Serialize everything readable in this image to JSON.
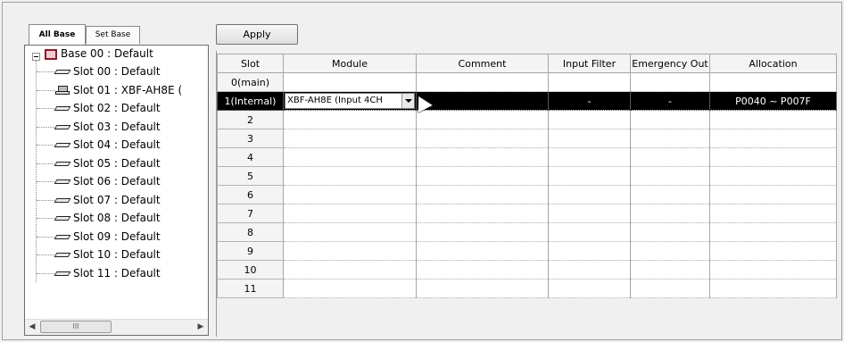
{
  "tabs": [
    "All Base",
    "Set Base"
  ],
  "apply_label": "Apply",
  "tree": {
    "root": "Base 00 : Default",
    "slots": [
      "Slot 00 : Default",
      "Slot 01 : XBF-AH8E (",
      "Slot 02 : Default",
      "Slot 03 : Default",
      "Slot 04 : Default",
      "Slot 05 : Default",
      "Slot 06 : Default",
      "Slot 07 : Default",
      "Slot 08 : Default",
      "Slot 09 : Default",
      "Slot 10 : Default",
      "Slot 11 : Default"
    ]
  },
  "scroll_thumb_label": "III",
  "grid": {
    "columns": [
      "Slot",
      "Module",
      "Comment",
      "Input Filter",
      "Emergency Out",
      "Allocation"
    ],
    "rows": [
      {
        "slot": "0(main)",
        "module": "",
        "comment": "",
        "filter": "",
        "emergency": "",
        "allocation": ""
      },
      {
        "slot": "1(Internal)",
        "module": "XBF-AH8E (Input 4CH",
        "comment": "",
        "filter": "-",
        "emergency": "-",
        "allocation": "P0040 ~ P007F"
      },
      {
        "slot": "2",
        "module": "",
        "comment": "",
        "filter": "",
        "emergency": "",
        "allocation": ""
      },
      {
        "slot": "3",
        "module": "",
        "comment": "",
        "filter": "",
        "emergency": "",
        "allocation": ""
      },
      {
        "slot": "4",
        "module": "",
        "comment": "",
        "filter": "",
        "emergency": "",
        "allocation": ""
      },
      {
        "slot": "5",
        "module": "",
        "comment": "",
        "filter": "",
        "emergency": "",
        "allocation": ""
      },
      {
        "slot": "6",
        "module": "",
        "comment": "",
        "filter": "",
        "emergency": "",
        "allocation": ""
      },
      {
        "slot": "7",
        "module": "",
        "comment": "",
        "filter": "",
        "emergency": "",
        "allocation": ""
      },
      {
        "slot": "8",
        "module": "",
        "comment": "",
        "filter": "",
        "emergency": "",
        "allocation": ""
      },
      {
        "slot": "9",
        "module": "",
        "comment": "",
        "filter": "",
        "emergency": "",
        "allocation": ""
      },
      {
        "slot": "10",
        "module": "",
        "comment": "",
        "filter": "",
        "emergency": "",
        "allocation": ""
      },
      {
        "slot": "11",
        "module": "",
        "comment": "",
        "filter": "",
        "emergency": "",
        "allocation": ""
      }
    ]
  },
  "colors": {
    "selected_row": "#000000",
    "base_icon": "#8a1b2a"
  }
}
